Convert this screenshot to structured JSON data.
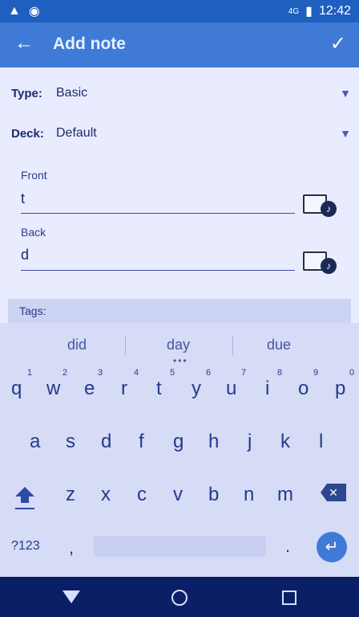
{
  "statusbar": {
    "time": "12:42",
    "network_label": "4G",
    "icons": [
      "warning-icon",
      "camera-icon",
      "signal-icon",
      "battery-icon"
    ]
  },
  "appbar": {
    "title": "Add note",
    "icons": [
      "back-arrow-icon",
      "check-icon"
    ]
  },
  "form": {
    "type_label": "Type:",
    "type_value": "Basic",
    "deck_label": "Deck:",
    "deck_value": "Default",
    "front_label": "Front",
    "front_value": "t",
    "back_label": "Back",
    "back_value": "d",
    "tags_label": "Tags:"
  },
  "keyboard": {
    "suggestions": [
      "did",
      "day",
      "due"
    ],
    "row1_hints": [
      "1",
      "2",
      "3",
      "4",
      "5",
      "6",
      "7",
      "8",
      "9",
      "0"
    ],
    "row1": [
      "q",
      "w",
      "e",
      "r",
      "t",
      "y",
      "u",
      "i",
      "o",
      "p"
    ],
    "row2": [
      "a",
      "s",
      "d",
      "f",
      "g",
      "h",
      "j",
      "k",
      "l"
    ],
    "row3": [
      "z",
      "x",
      "c",
      "v",
      "b",
      "n",
      "m"
    ],
    "symbols_label": "?123",
    "comma": ",",
    "period": "."
  },
  "colors": {
    "appbar": "#3f7ad6",
    "statusbar": "#1f5fbf",
    "navbar": "#0b1f66"
  }
}
